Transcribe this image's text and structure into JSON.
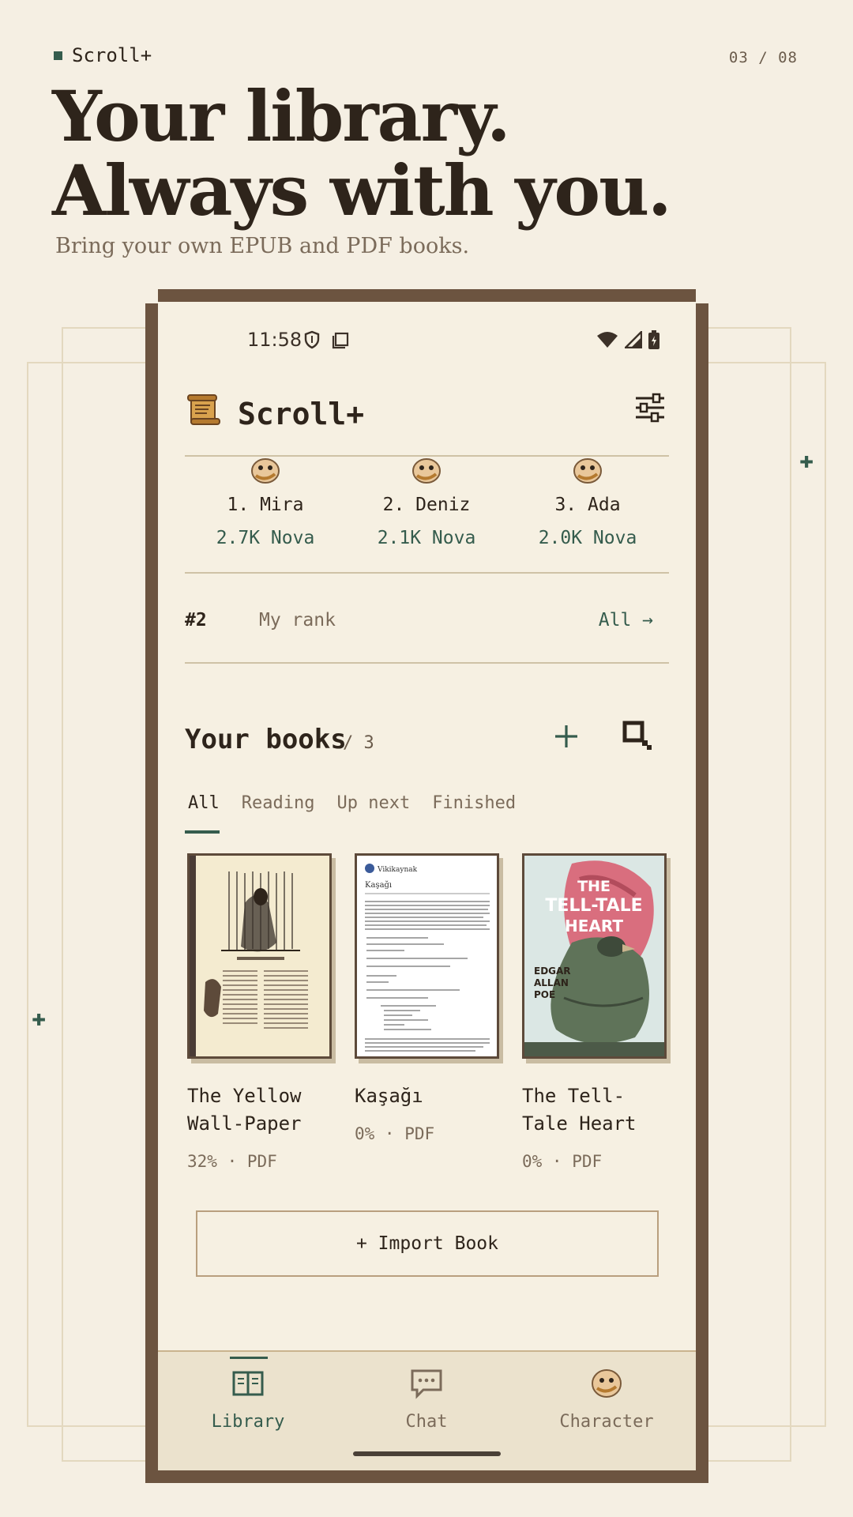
{
  "brand": {
    "name": "Scroll+",
    "page_counter": "03 / 08"
  },
  "hero": {
    "headline_line1": "Your library.",
    "headline_line2": "Always with you.",
    "subhead": "Bring your own EPUB and PDF books."
  },
  "status_bar": {
    "time": "11:58"
  },
  "app": {
    "title": "Scroll+"
  },
  "leaderboard": [
    {
      "name": "1. Mira",
      "score": "2.7K Nova"
    },
    {
      "name": "2. Deniz",
      "score": "2.1K Nova"
    },
    {
      "name": "3. Ada",
      "score": "2.0K Nova"
    }
  ],
  "my_rank": {
    "rank": "#2",
    "label": "My rank",
    "link": "All →"
  },
  "books_section": {
    "title": "Your books",
    "count": "/ 3"
  },
  "filter_tabs": [
    {
      "label": "All"
    },
    {
      "label": "Reading"
    },
    {
      "label": "Up next"
    },
    {
      "label": "Finished"
    }
  ],
  "books": [
    {
      "title": "The Yellow Wall-Paper",
      "meta": "32% · PDF"
    },
    {
      "title": "Kaşağı",
      "meta": "0% · PDF"
    },
    {
      "title": "The Tell-Tale Heart",
      "meta": "0% · PDF"
    }
  ],
  "covers": {
    "tell_tale_line1": "THE",
    "tell_tale_line2": "TELL-TALE",
    "tell_tale_line3": "HEART",
    "tell_tale_author1": "EDGAR",
    "tell_tale_author2": "ALLAN",
    "tell_tale_author3": "POE",
    "kasagi_header": "Vikikaynak",
    "kasagi_title": "Kaşağı"
  },
  "import_button": {
    "label": "+ Import Book"
  },
  "bottom_nav": [
    {
      "label": "Library",
      "icon": "book-open-icon"
    },
    {
      "label": "Chat",
      "icon": "chat-bubble-icon"
    },
    {
      "label": "Character",
      "icon": "mascot-icon"
    }
  ],
  "colors": {
    "accent": "#355c4d",
    "background": "#f5efe3",
    "frame": "#6c5440",
    "text": "#2e241b"
  }
}
